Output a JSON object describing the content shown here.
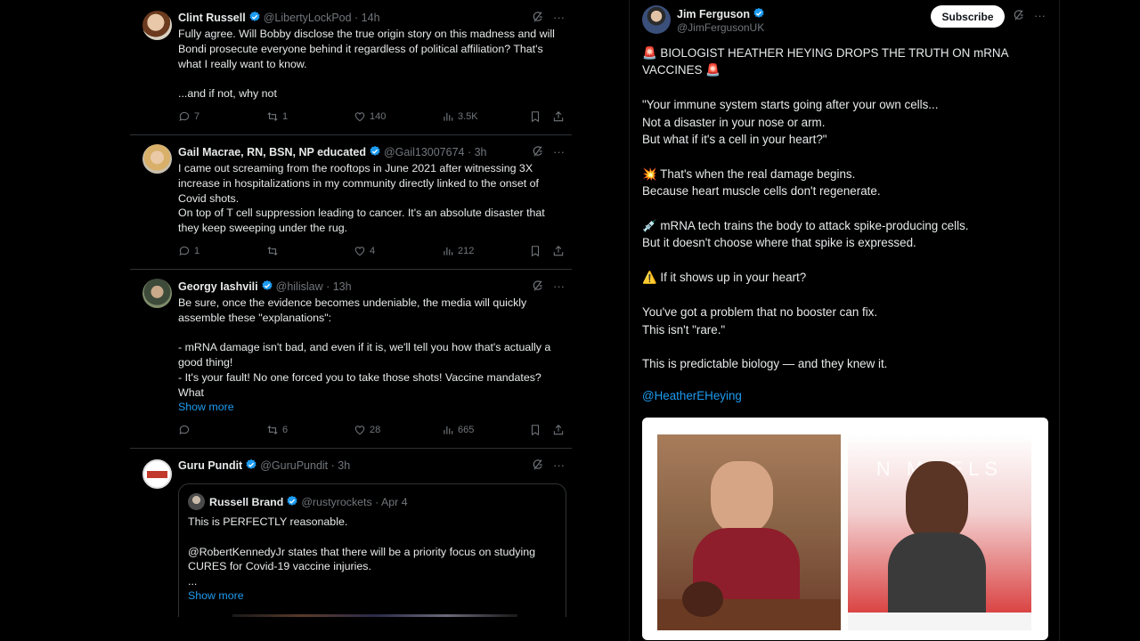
{
  "tweets": [
    {
      "name": "Clint Russell",
      "handle": "@LibertyLockPod · 14h",
      "text": "Fully agree. Will Bobby disclose the true origin story on this madness and will Bondi prosecute everyone behind it regardless of political affiliation? That's what I really want to know.\n\n...and if not, why not",
      "replies": "7",
      "reposts": "1",
      "likes": "140",
      "views": "3.5K"
    },
    {
      "name": "Gail Macrae, RN, BSN, NP educated",
      "handle": "@Gail13007674 · 3h",
      "text": "I came out screaming from the rooftops in June 2021 after witnessing 3X increase in hospitalizations in my community directly linked to the onset of Covid shots.\nOn top of T cell suppression leading to cancer. It's an absolute disaster that they keep sweeping under the rug.",
      "replies": "1",
      "reposts": "",
      "likes": "4",
      "views": "212"
    },
    {
      "name": "Georgy Iashvili",
      "handle": "@hilislaw · 13h",
      "text": "Be sure, once the evidence becomes undeniable, the media will quickly assemble these \"explanations\":\n\n- mRNA damage isn't bad, and even if it is, we'll tell you how that's actually a good thing!\n- It's your fault! No one forced you to take those shots! Vaccine mandates? What",
      "show_more": "Show more",
      "replies": "",
      "reposts": "6",
      "likes": "28",
      "views": "665"
    },
    {
      "name": "Guru Pundit",
      "handle": "@GuruPundit · 3h",
      "quote": {
        "name": "Russell Brand",
        "handle": "@rustyrockets · Apr 4",
        "text": "This is PERFECTLY reasonable.\n\n@RobertKennedyJr states that there will be a priority focus on studying CURES for Covid-19 vaccine injuries.\n...",
        "show_more": "Show more"
      }
    }
  ],
  "main_post": {
    "name": "Jim Ferguson",
    "handle": "@JimFergusonUK",
    "subscribe_label": "Subscribe",
    "text": "🚨 BIOLOGIST HEATHER HEYING DROPS THE TRUTH ON mRNA VACCINES 🚨\n\n\"Your immune system starts going after your own cells...\nNot a disaster in your nose or arm.\nBut what if it's a cell in your heart?\"\n\n💥 That's when the real damage begins.\nBecause heart muscle cells don't regenerate.\n\n💉 mRNA tech trains the body to attack spike-producing cells.\nBut it doesn't choose where that spike is expressed.\n\n⚠️ If it shows up in your heart?\n\nYou've got a problem that no booster can fix.\nThis isn't \"rare.\"\n\nThis is predictable biology — and they knew it.",
    "mention": "@HeatherEHeying",
    "video_overlay_text": "N MI  ELS"
  },
  "colors": {
    "background": "#000000",
    "text": "#e7e9ea",
    "muted": "#71767b",
    "accent": "#1d9bf0",
    "border": "#2f3336"
  },
  "icons": [
    "verified-badge-icon",
    "grok-icon",
    "more-icon",
    "reply-icon",
    "repost-icon",
    "like-icon",
    "views-icon",
    "bookmark-icon",
    "share-icon"
  ]
}
